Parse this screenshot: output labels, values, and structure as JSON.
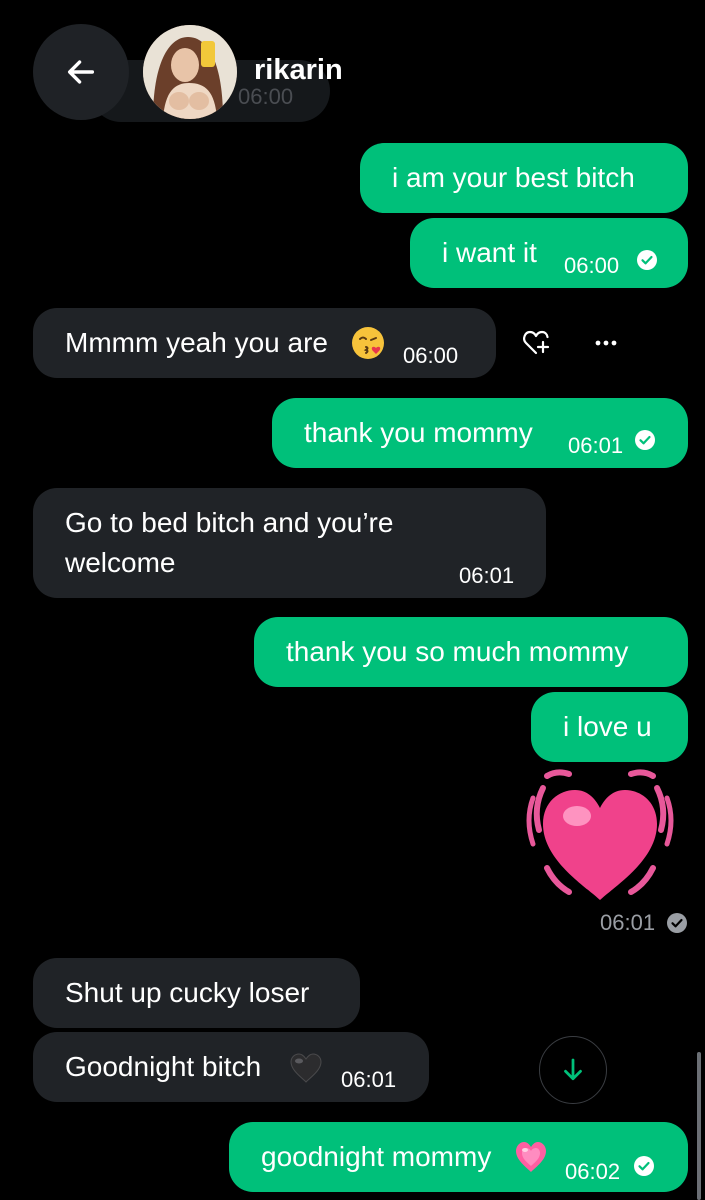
{
  "header": {
    "username": "rikarin",
    "ghost_time": "06:00",
    "back_icon": "arrow-left-icon"
  },
  "messages": [
    {
      "dir": "out",
      "text": "i am your best bitch"
    },
    {
      "dir": "out",
      "text": "i want it",
      "time": "06:00",
      "status": "read"
    },
    {
      "dir": "in",
      "text": "Mmmm yeah you are",
      "emoji": "kissing-face-emoji",
      "time": "06:00"
    },
    {
      "dir": "out",
      "text": "thank you mommy",
      "time": "06:01",
      "status": "read"
    },
    {
      "dir": "in",
      "text_line1": "Go to bed bitch and you’re",
      "text_line2": "welcome",
      "time": "06:01"
    },
    {
      "dir": "out",
      "text": "thank you so much mommy"
    },
    {
      "dir": "out",
      "text": "i love u"
    },
    {
      "dir": "out",
      "sticker": "beating-heart-emoji",
      "time": "06:01",
      "status": "read"
    },
    {
      "dir": "in",
      "text": "Shut up cucky loser"
    },
    {
      "dir": "in",
      "text": "Goodnight bitch",
      "emoji": "black-heart-emoji",
      "time": "06:01"
    },
    {
      "dir": "out",
      "text": "goodnight mommy",
      "emoji": "growing-heart-emoji",
      "time": "06:02",
      "status": "read"
    }
  ],
  "actions": {
    "react_icon": "heart-plus-icon",
    "more_icon": "more-horizontal-icon"
  },
  "colors": {
    "outgoing_bubble": "#00c07a",
    "incoming_bubble": "#202327",
    "background": "#000000"
  }
}
